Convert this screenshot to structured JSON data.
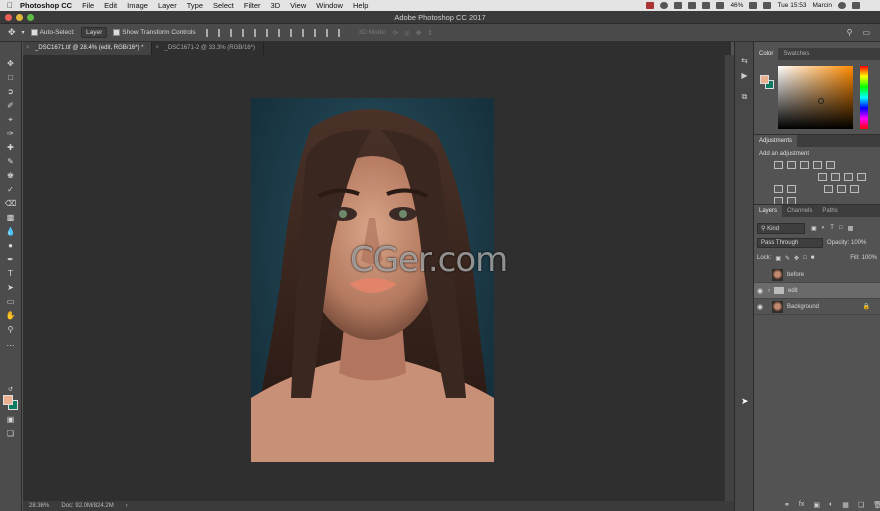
{
  "menubar": {
    "app_name": "Photoshop CC",
    "items": [
      "File",
      "Edit",
      "Image",
      "Layer",
      "Type",
      "Select",
      "Filter",
      "3D",
      "View",
      "Window",
      "Help"
    ],
    "battery": "46%",
    "clock": "Tue 15:53",
    "user": "Marcin"
  },
  "window": {
    "title": "Adobe Photoshop CC 2017"
  },
  "options": {
    "auto_select_label": "Auto-Select:",
    "auto_select_value": "Layer",
    "transform_label": "Show Transform Controls",
    "mode_3d": "3D Mode:"
  },
  "tabs": [
    {
      "label": "_DSC1671.tif @ 28.4% (edit, RGB/16*) *",
      "active": true
    },
    {
      "label": "_DSC1671-2 @ 33.3% (RGB/16*)",
      "active": false
    }
  ],
  "watermark": "CGer.com",
  "status": {
    "zoom": "28.36%",
    "doc": "Doc: 92.0M/824.2M"
  },
  "color_panel": {
    "tabs": [
      "Color",
      "Swatches"
    ],
    "foreground": "#e8b08e",
    "background": "#0d7b62"
  },
  "adjustments": {
    "title": "Adjustments",
    "subtitle": "Add an adjustment"
  },
  "layers_panel": {
    "tabs": [
      "Layers",
      "Channels",
      "Paths"
    ],
    "filter": "Kind",
    "blend_mode": "Pass Through",
    "opacity_label": "Opacity:",
    "opacity_value": "100%",
    "lock_label": "Lock:",
    "fill_label": "Fill:",
    "fill_value": "100%",
    "layers": [
      {
        "name": "before",
        "visible": false,
        "type": "image"
      },
      {
        "name": "edit",
        "visible": true,
        "type": "group",
        "selected": true
      },
      {
        "name": "Background",
        "visible": true,
        "type": "image",
        "locked": true
      }
    ],
    "footer_icons": [
      "link-icon",
      "fx-icon",
      "mask-icon",
      "adjustment-layer-icon",
      "group-icon",
      "new-layer-icon",
      "trash-icon"
    ]
  }
}
